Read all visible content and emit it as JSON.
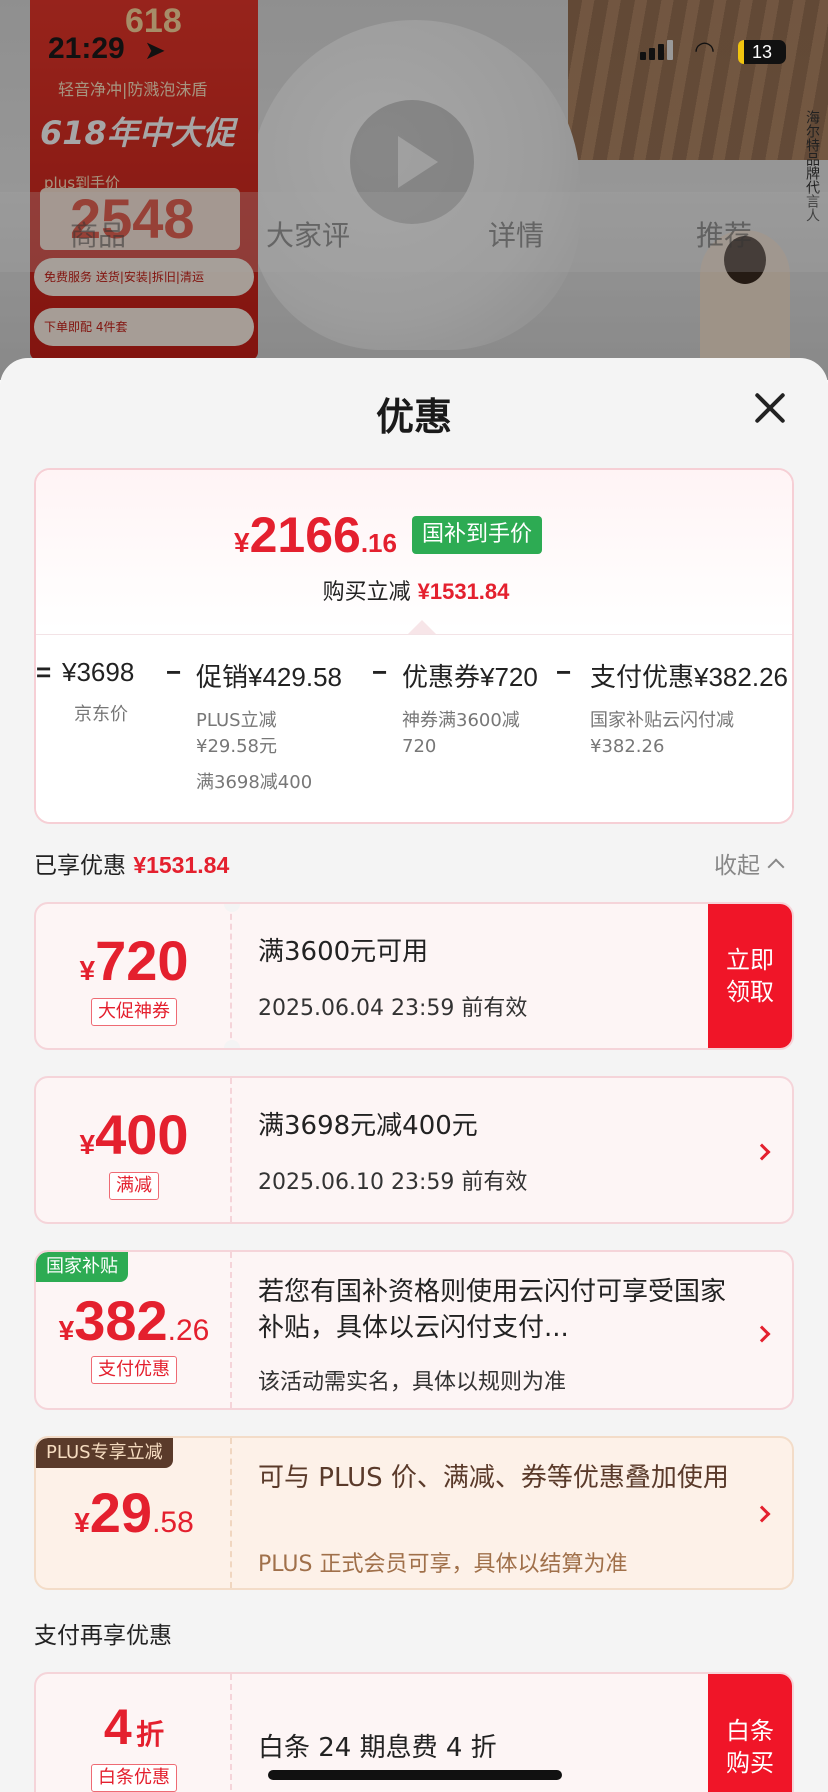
{
  "status": {
    "time": "21:29",
    "battery": "13"
  },
  "background": {
    "promo_618": "618",
    "promo_line": "轻音净冲|防溅泡沫盾",
    "promo_big": "618年中大促",
    "plus_label": "plus到手价",
    "plus_price": "2548",
    "service1": "免费服务 送货|安装|拆旧|清运",
    "service2": "下单即配 4件套",
    "spokes": "海尔特品牌代言人",
    "nav": [
      "商品",
      "大家评",
      "详情",
      "推荐"
    ]
  },
  "sheet": {
    "title": "优惠"
  },
  "summary": {
    "final_currency": "¥",
    "final_int": "2166",
    "final_dec": ".16",
    "badge": "国补到手价",
    "reduce_label": "购买立减",
    "reduce_value": "¥1531.84",
    "breakdown": [
      {
        "op": "=",
        "name": "",
        "value": "¥3698",
        "desc": "京东价"
      },
      {
        "op": "−",
        "name": "促销",
        "value": "¥429.58",
        "desc": "PLUS立减 ¥29.58元",
        "desc2": "满3698减400"
      },
      {
        "op": "−",
        "name": "优惠券",
        "value": "¥720",
        "desc": "神券满3600减 720"
      },
      {
        "op": "−",
        "name": "支付优惠",
        "value": "¥382.26",
        "desc": "国家补贴云闪付减 ¥382.26"
      }
    ]
  },
  "enjoyed": {
    "label": "已享优惠",
    "value": "¥1531.84",
    "collapse": "收起"
  },
  "coupons": [
    {
      "currency": "¥",
      "int": "720",
      "dec": "",
      "tag": "大促神券",
      "title": "满3600元可用",
      "sub": "2025.06.04 23:59 前有效",
      "action": "立即领取"
    },
    {
      "currency": "¥",
      "int": "400",
      "dec": "",
      "tag": "满减",
      "title": "满3698元减400元",
      "sub": "2025.06.10 23:59 前有效"
    },
    {
      "currency": "¥",
      "int": "382",
      "dec": ".26",
      "tag": "支付优惠",
      "corner": "国家补贴",
      "title": "若您有国补资格则使用云闪付可享受国家补贴，具体以云闪付支付...",
      "sub": "该活动需实名，具体以规则为准"
    },
    {
      "currency": "¥",
      "int": "29",
      "dec": ".58",
      "corner": "PLUS专享立减",
      "title": "可与 PLUS 价、满减、券等优惠叠加使用",
      "sub": "PLUS 正式会员可享，具体以结算为准"
    }
  ],
  "pay_section": {
    "title": "支付再享优惠"
  },
  "pay_coupon": {
    "int": "4",
    "unit": "折",
    "tag": "白条优惠",
    "title": "白条 24 期息费 4 折",
    "action": "白条购买"
  },
  "colors": {
    "accent": "#e4202e",
    "green_badge": "#2dab53",
    "action_red": "#f01528",
    "plus_brown": "#5a3a2a"
  }
}
